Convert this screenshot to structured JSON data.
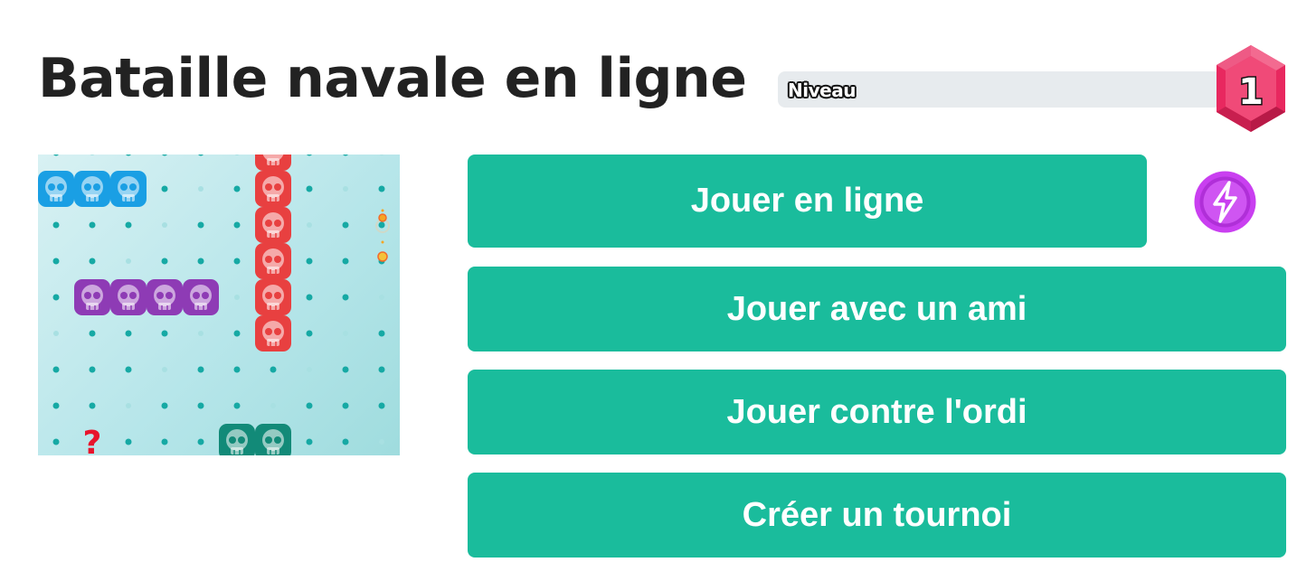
{
  "page": {
    "title": "Bataille navale en ligne"
  },
  "level": {
    "label": "Niveau",
    "value": "1",
    "progress": 0.0
  },
  "menu": {
    "play_online": "Jouer en ligne",
    "play_friend": "Jouer avec un ami",
    "play_computer": "Jouer contre l'ordi",
    "create_tournament": "Créer un tournoi"
  },
  "board": {
    "unknown_marker": "?",
    "ships": [
      {
        "color": "#1a9fe4",
        "cells": [
          [
            0,
            0
          ],
          [
            1,
            0
          ],
          [
            2,
            0
          ]
        ]
      },
      {
        "color": "#e84040",
        "cells": [
          [
            6,
            -1
          ],
          [
            6,
            0
          ],
          [
            6,
            1
          ],
          [
            6,
            2
          ],
          [
            6,
            3
          ],
          [
            6,
            4
          ]
        ]
      },
      {
        "color": "#8e3bb5",
        "cells": [
          [
            1,
            3
          ],
          [
            2,
            3
          ],
          [
            3,
            3
          ],
          [
            4,
            3
          ]
        ]
      },
      {
        "color": "#128a78",
        "cells": [
          [
            5,
            7
          ],
          [
            6,
            7
          ]
        ]
      }
    ]
  },
  "colors": {
    "accent": "#1abc9c",
    "badge": "#e8285f",
    "lightning": "#c93ff0",
    "title": "#222222"
  },
  "icons": {
    "level_badge": "hexagon-level-icon",
    "bonus": "lightning-icon",
    "ship_segment": "skull-icon"
  }
}
